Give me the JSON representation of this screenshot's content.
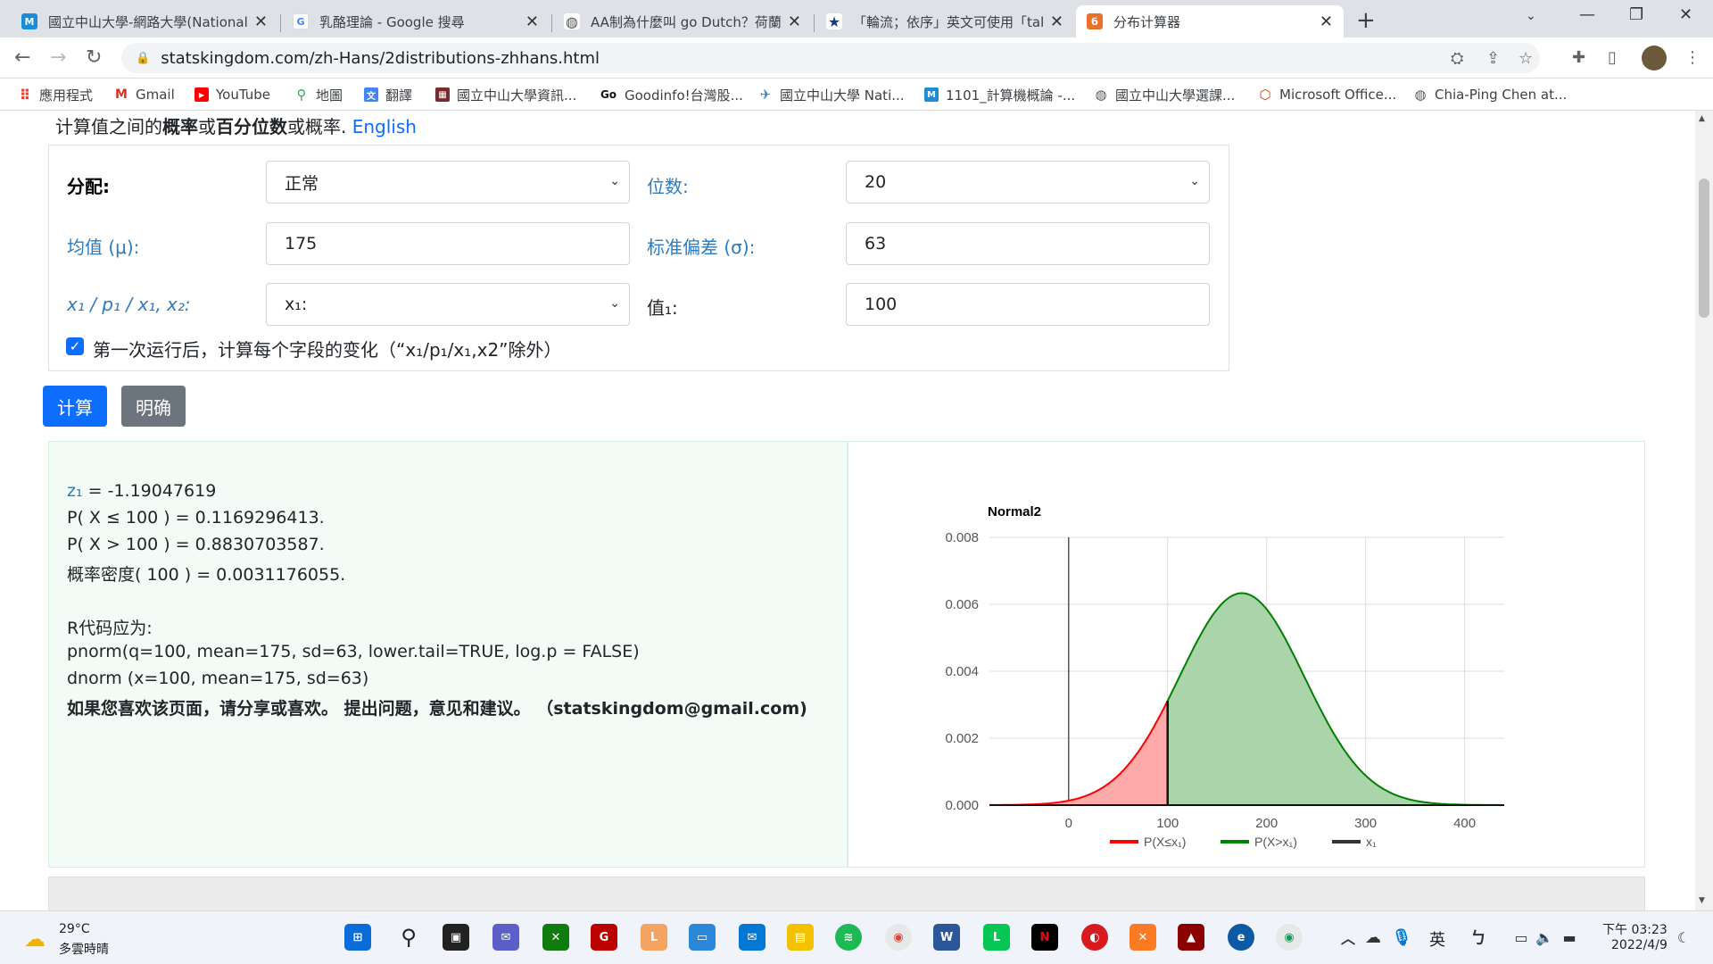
{
  "browser": {
    "tabs": [
      {
        "title": "國立中山大學-網路大學(National",
        "icon": "m-logo-icon",
        "color": "#1a8cd8",
        "glyph": "M"
      },
      {
        "title": "乳酪理論 - Google 搜尋",
        "icon": "google-icon",
        "color": "#ffffff",
        "glyph": "G"
      },
      {
        "title": "AA制為什麼叫 go Dutch？荷蘭人",
        "icon": "globe-icon",
        "color": "#555555",
        "glyph": "◍"
      },
      {
        "title": "「輪流；依序」英文可使用「tak",
        "icon": "star-icon",
        "color": "#1a3a8c",
        "glyph": "★"
      },
      {
        "title": "分布计算器",
        "icon": "statskingdom-icon",
        "color": "#e8722c",
        "glyph": "б"
      }
    ],
    "url": "statskingdom.com/zh-Hans/2distributions-zhhans.html",
    "bookmarks": [
      {
        "label": "應用程式",
        "icon": "apps-grid-icon",
        "color": "#ea4335",
        "glyph": "⠿"
      },
      {
        "label": "Gmail",
        "icon": "gmail-icon",
        "color": "#d93025",
        "glyph": "M"
      },
      {
        "label": "YouTube",
        "icon": "youtube-icon",
        "color": "#ff0000",
        "glyph": "▶"
      },
      {
        "label": "地圖",
        "icon": "maps-pin-icon",
        "color": "#34a853",
        "glyph": "⚲"
      },
      {
        "label": "翻譯",
        "icon": "translate-icon",
        "color": "#4285f4",
        "glyph": "文"
      },
      {
        "label": "國立中山大學資訊...",
        "icon": "nsysu-icon",
        "color": "#7a2a2a",
        "glyph": "▦"
      },
      {
        "label": "Goodinfo!台灣股...",
        "icon": "goodinfo-icon",
        "color": "#111111",
        "glyph": "Go"
      },
      {
        "label": "國立中山大學 Nati...",
        "icon": "plane-icon",
        "color": "#2a8ad8",
        "glyph": "✈"
      },
      {
        "label": "1101_計算機概論 -...",
        "icon": "m-logo-icon",
        "color": "#1a8cd8",
        "glyph": "M"
      },
      {
        "label": "國立中山大學選課...",
        "icon": "globe-icon",
        "color": "#555555",
        "glyph": "◍"
      },
      {
        "label": "Microsoft Office...",
        "icon": "office-icon",
        "color": "#d83b01",
        "glyph": "⬡"
      },
      {
        "label": "Chia-Ping Chen at...",
        "icon": "globe-icon",
        "color": "#555555",
        "glyph": "◍"
      }
    ]
  },
  "page": {
    "intro": {
      "prefix": "计算值之间的",
      "bold1": "概率",
      "mid1": "或",
      "bold2": "百分位数",
      "mid2": "或概率. ",
      "link": "English"
    },
    "form": {
      "distribution_label": "分配:",
      "distribution_value": "正常",
      "digits_label": "位数:",
      "digits_value": "20",
      "mean_label": "均值 (μ):",
      "mean_value": "175",
      "sd_label": "标准偏差 (σ):",
      "sd_value": "63",
      "x_label": "x₁ / p₁ / x₁, x₂:",
      "x_value": "x₁:",
      "val_label": "值₁:",
      "val_value": "100",
      "checkbox_label": "第一次运行后，计算每个字段的变化（“x₁/p₁/x₁,x2”除外）",
      "checkbox_checked": true
    },
    "buttons": {
      "calculate": "计算",
      "clear": "明确"
    },
    "results": {
      "z_name": "z₁",
      "z_value": " = -1.19047619",
      "p_le": "P( X ≤ 100 ) = 0.1169296413.",
      "p_gt": "P( X > 100 ) = 0.8830703587.",
      "density": "概率密度( 100 ) = 0.0031176055.",
      "r_title": "R代码应为:",
      "r_line1": "pnorm(q=100, mean=175, sd=63, lower.tail=TRUE, log.p = FALSE)",
      "r_line2": "dnorm (x=100, mean=175, sd=63)",
      "share": "如果您喜欢该页面，请分享或喜欢。 提出问题，意见和建议。 （statskingdom@gmail.com)"
    }
  },
  "chart_data": {
    "type": "area",
    "title": "Normal2",
    "distribution": "normal",
    "mean": 175,
    "sd": 63,
    "x1": 100,
    "xlim": [
      -80,
      440
    ],
    "ylim": [
      0,
      0.008
    ],
    "x_ticks": [
      "0",
      "100",
      "200",
      "300",
      "400"
    ],
    "y_ticks": [
      "0.000",
      "0.002",
      "0.004",
      "0.006",
      "0.008"
    ],
    "legend_position": "bottom",
    "series": [
      {
        "name": "P(X≤x₁)",
        "color": "#ff0000",
        "fill": "#ffaaaa"
      },
      {
        "name": "P(X>x₁)",
        "color": "#008000",
        "fill": "#aad4aa"
      },
      {
        "name": "x₁",
        "color": "#333333"
      }
    ]
  },
  "taskbar": {
    "weather_temp": "29°C",
    "weather_desc": "多雲時晴",
    "ime": "英",
    "time": "下午 03:23",
    "date": "2022/4/9"
  }
}
